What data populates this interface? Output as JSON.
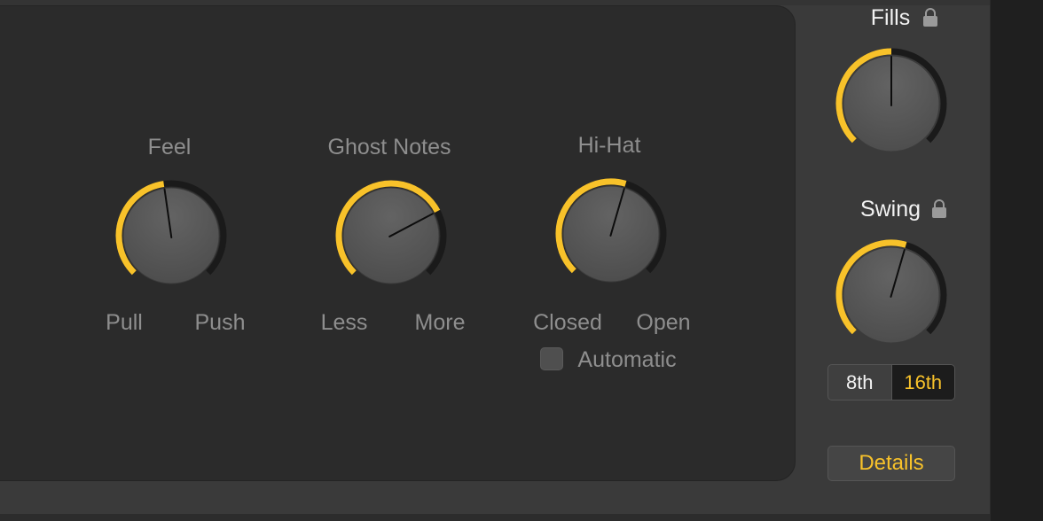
{
  "colors": {
    "accent": "#f8c22a",
    "track": "#1a1a1a",
    "knob_body": "#5a5a5a",
    "label_gray": "#8e8e8e"
  },
  "panel": {
    "feel": {
      "title": "Feel",
      "min_label": "Pull",
      "max_label": "Push",
      "value": 0.47
    },
    "ghost_notes": {
      "title": "Ghost Notes",
      "min_label": "Less",
      "max_label": "More",
      "value": 0.73
    },
    "hi_hat": {
      "title": "Hi-Hat",
      "min_label": "Closed",
      "max_label": "Open",
      "value": 0.56,
      "automatic_label": "Automatic",
      "automatic_checked": false
    }
  },
  "side": {
    "fills": {
      "title": "Fills",
      "value": 0.5,
      "icon": "lock-icon"
    },
    "swing": {
      "title": "Swing",
      "value": 0.56,
      "icon": "lock-icon",
      "note_options": [
        "8th",
        "16th"
      ],
      "selected_note": "16th"
    },
    "details_label": "Details"
  }
}
